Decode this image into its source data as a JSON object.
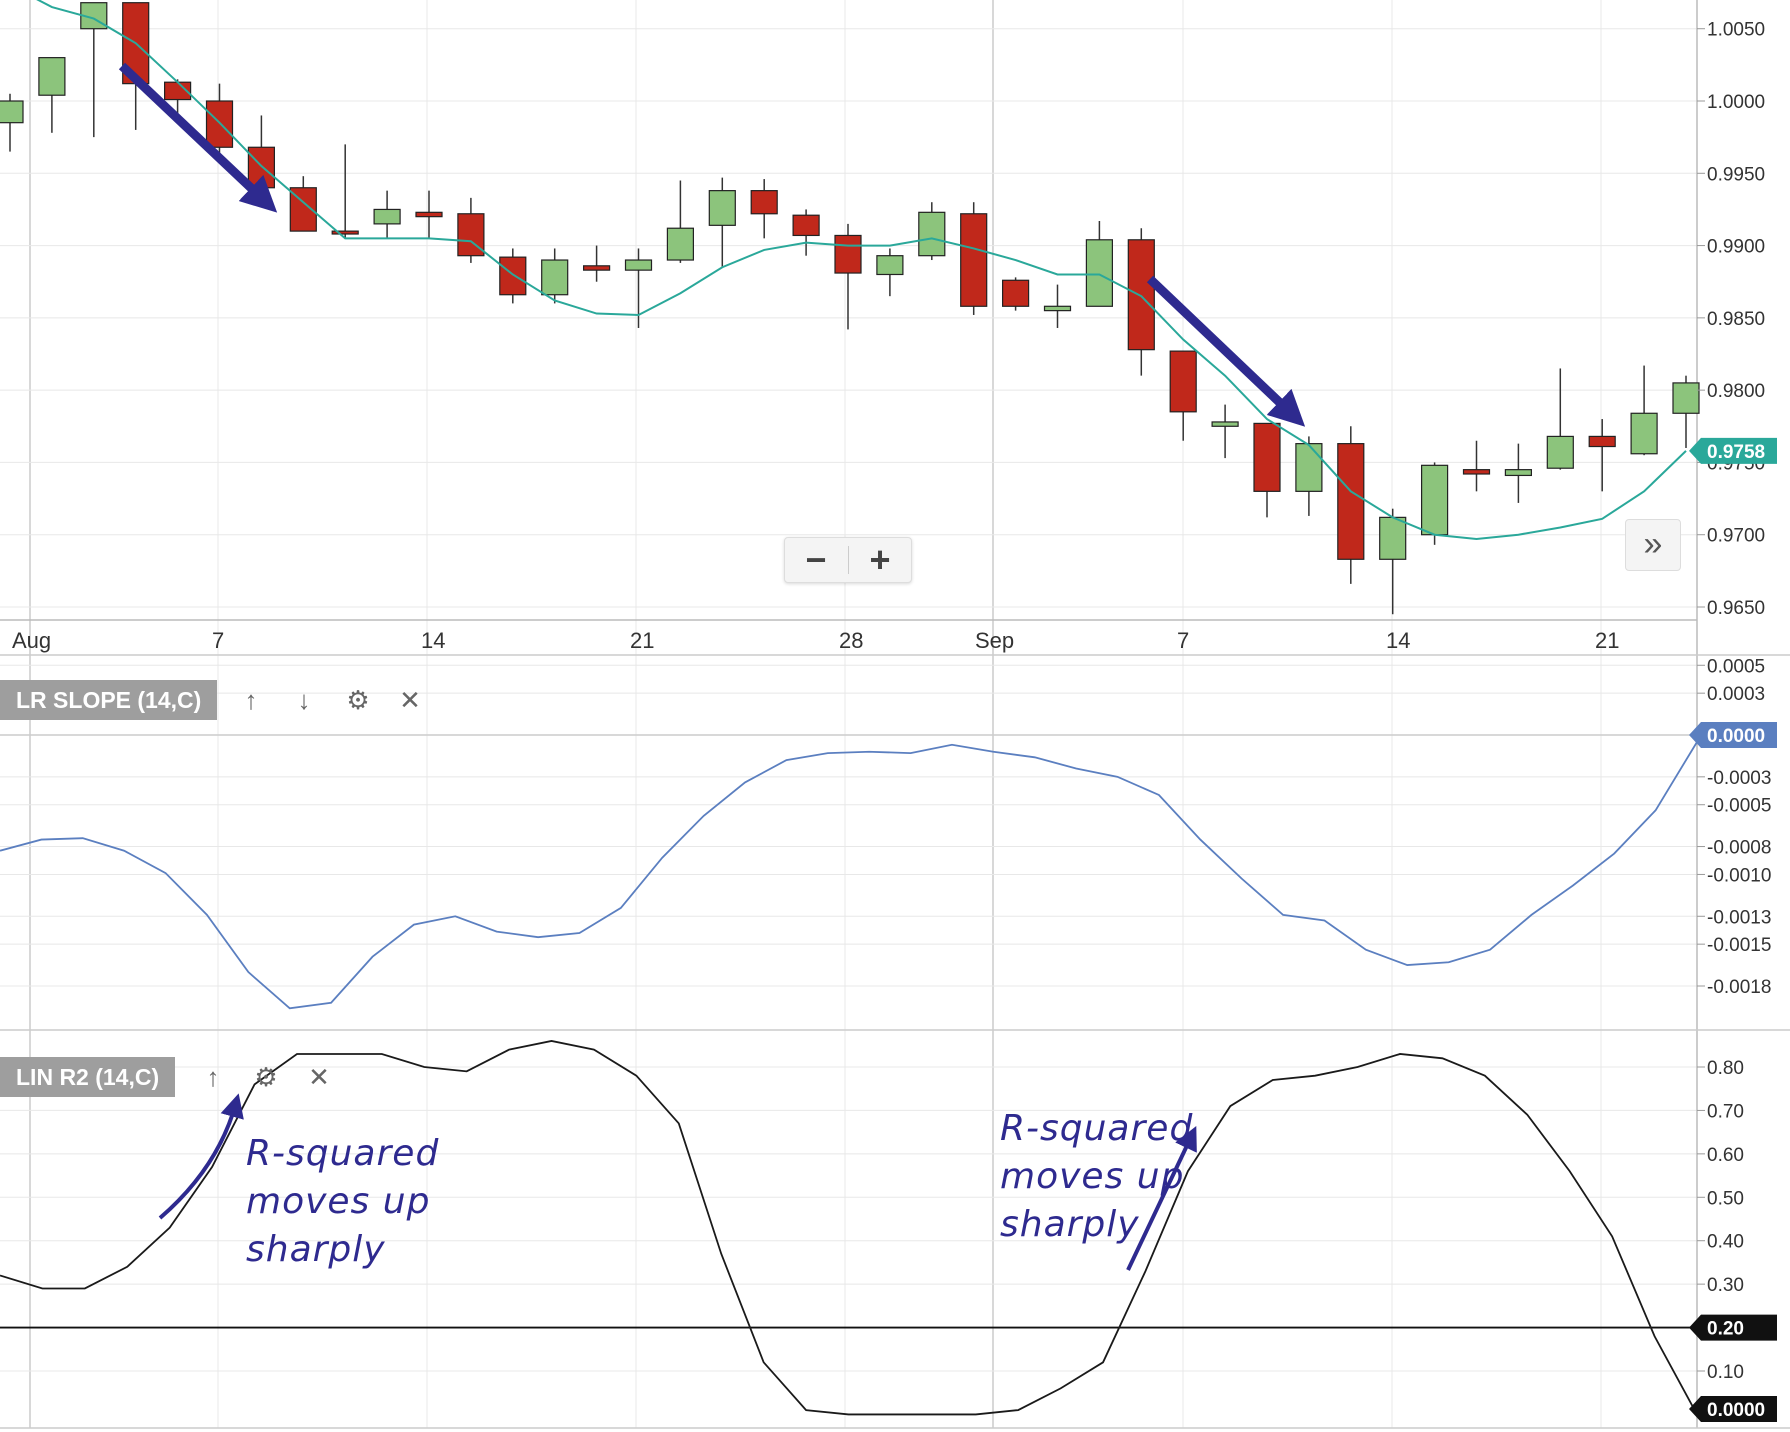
{
  "colors": {
    "up": "#8cc47c",
    "down": "#c0281b",
    "sma": "#2aa89a",
    "slope": "#5b7fc0",
    "r2": "#1a1a1a",
    "grid": "#e8e8e8",
    "arrow": "#2e2a8f",
    "badge_last": "#2aa89a",
    "badge_slope": "#5b7fc0",
    "badge_r2": "#111111"
  },
  "panels": {
    "slope_label": "LR SLOPE (14,C)",
    "r2_label": "LIN R2 (14,C)"
  },
  "icons": {
    "up": "arrow-up-icon",
    "down": "arrow-down-icon",
    "settings": "gear-icon",
    "close": "close-icon",
    "zoom_out": "minus-icon",
    "zoom_in": "plus-icon",
    "scroll": "double-chevron-right-icon"
  },
  "controls": {
    "up": "↑",
    "down": "↓",
    "settings": "⚙",
    "close": "✕",
    "zoom_out": "−",
    "zoom_in": "+",
    "scroll": "»"
  },
  "annotations": [
    {
      "lines": [
        "R-squared",
        "moves up",
        "sharply"
      ]
    },
    {
      "lines": [
        "R-squared",
        "moves up",
        "sharply"
      ]
    }
  ],
  "chart_data": [
    {
      "type": "candlestick",
      "x_labels": [
        "Aug",
        "7",
        "14",
        "21",
        "28",
        "Sep",
        "7",
        "14",
        "21"
      ],
      "ylim": [
        0.964,
        1.0068
      ],
      "y_ticks": [
        "0.9650",
        "0.9700",
        "0.9750",
        "0.9800",
        "0.9850",
        "0.9900",
        "0.9950",
        "1.0000",
        "1.0050"
      ],
      "last_value": "0.9758",
      "candles": [
        {
          "o": 0.9985,
          "h": 1.0005,
          "l": 0.9965,
          "c": 1.0
        },
        {
          "o": 1.0004,
          "h": 1.0024,
          "l": 0.9978,
          "c": 1.003
        },
        {
          "o": 1.005,
          "h": 1.0068,
          "l": 0.9975,
          "c": 1.0068
        },
        {
          "o": 1.0068,
          "h": 1.0068,
          "l": 0.998,
          "c": 1.0012
        },
        {
          "o": 1.0013,
          "h": 1.0015,
          "l": 0.999,
          "c": 1.0001
        },
        {
          "o": 1.0,
          "h": 1.0012,
          "l": 0.9958,
          "c": 0.9968
        },
        {
          "o": 0.9968,
          "h": 0.999,
          "l": 0.9932,
          "c": 0.994
        },
        {
          "o": 0.994,
          "h": 0.9948,
          "l": 0.991,
          "c": 0.991
        },
        {
          "o": 0.991,
          "h": 0.997,
          "l": 0.9905,
          "c": 0.9908
        },
        {
          "o": 0.9915,
          "h": 0.9938,
          "l": 0.9905,
          "c": 0.9925
        },
        {
          "o": 0.9923,
          "h": 0.9938,
          "l": 0.9905,
          "c": 0.992
        },
        {
          "o": 0.9922,
          "h": 0.9933,
          "l": 0.9888,
          "c": 0.9893
        },
        {
          "o": 0.9892,
          "h": 0.9898,
          "l": 0.986,
          "c": 0.9866
        },
        {
          "o": 0.9866,
          "h": 0.9898,
          "l": 0.986,
          "c": 0.989
        },
        {
          "o": 0.9886,
          "h": 0.99,
          "l": 0.9875,
          "c": 0.9883
        },
        {
          "o": 0.9883,
          "h": 0.9898,
          "l": 0.9843,
          "c": 0.989
        },
        {
          "o": 0.989,
          "h": 0.9945,
          "l": 0.9888,
          "c": 0.9912
        },
        {
          "o": 0.9914,
          "h": 0.9947,
          "l": 0.9885,
          "c": 0.9938
        },
        {
          "o": 0.9938,
          "h": 0.9946,
          "l": 0.9905,
          "c": 0.9922
        },
        {
          "o": 0.9921,
          "h": 0.9925,
          "l": 0.9893,
          "c": 0.9907
        },
        {
          "o": 0.9907,
          "h": 0.9915,
          "l": 0.9842,
          "c": 0.9881
        },
        {
          "o": 0.988,
          "h": 0.9898,
          "l": 0.9865,
          "c": 0.9893
        },
        {
          "o": 0.9893,
          "h": 0.993,
          "l": 0.989,
          "c": 0.9923
        },
        {
          "o": 0.9922,
          "h": 0.993,
          "l": 0.9852,
          "c": 0.9858
        },
        {
          "o": 0.9876,
          "h": 0.9878,
          "l": 0.9855,
          "c": 0.9858
        },
        {
          "o": 0.9855,
          "h": 0.9873,
          "l": 0.9843,
          "c": 0.9858
        },
        {
          "o": 0.9858,
          "h": 0.9917,
          "l": 0.9858,
          "c": 0.9904
        },
        {
          "o": 0.9904,
          "h": 0.9912,
          "l": 0.981,
          "c": 0.9828
        },
        {
          "o": 0.9827,
          "h": 0.9827,
          "l": 0.9765,
          "c": 0.9785
        },
        {
          "o": 0.9775,
          "h": 0.979,
          "l": 0.9753,
          "c": 0.9778
        },
        {
          "o": 0.9777,
          "h": 0.9777,
          "l": 0.9712,
          "c": 0.973
        },
        {
          "o": 0.973,
          "h": 0.9768,
          "l": 0.9713,
          "c": 0.9763
        },
        {
          "o": 0.9763,
          "h": 0.9775,
          "l": 0.9666,
          "c": 0.9683
        },
        {
          "o": 0.9683,
          "h": 0.9718,
          "l": 0.9645,
          "c": 0.9712
        },
        {
          "o": 0.97,
          "h": 0.975,
          "l": 0.9693,
          "c": 0.9748
        },
        {
          "o": 0.9745,
          "h": 0.9765,
          "l": 0.973,
          "c": 0.9742
        },
        {
          "o": 0.9741,
          "h": 0.9763,
          "l": 0.9722,
          "c": 0.9745
        },
        {
          "o": 0.9746,
          "h": 0.9815,
          "l": 0.9745,
          "c": 0.9768
        },
        {
          "o": 0.9768,
          "h": 0.978,
          "l": 0.973,
          "c": 0.9761
        },
        {
          "o": 0.9756,
          "h": 0.9817,
          "l": 0.9755,
          "c": 0.9784
        },
        {
          "o": 0.9784,
          "h": 0.981,
          "l": 0.976,
          "c": 0.9805
        }
      ],
      "sma": [
        1.008,
        1.0065,
        1.0057,
        1.004,
        1.0013,
        0.9985,
        0.9955,
        0.993,
        0.9905,
        0.9905,
        0.9905,
        0.9903,
        0.988,
        0.9862,
        0.9853,
        0.9852,
        0.9867,
        0.9885,
        0.9897,
        0.9902,
        0.99,
        0.99,
        0.9905,
        0.9898,
        0.989,
        0.988,
        0.988,
        0.9865,
        0.9835,
        0.981,
        0.978,
        0.9762,
        0.973,
        0.9712,
        0.97,
        0.9697,
        0.97,
        0.9705,
        0.9711,
        0.973,
        0.9758
      ]
    },
    {
      "type": "line",
      "title": "LR SLOPE (14,C)",
      "ylim": [
        -0.002,
        0.0005
      ],
      "y_ticks": [
        "0.0005",
        "0.0003",
        "0.0000",
        "-0.0003",
        "-0.0005",
        "-0.0008",
        "-0.0010",
        "-0.0013",
        "-0.0015",
        "-0.0018"
      ],
      "last_value": "0.0000",
      "values": [
        -0.00083,
        -0.00075,
        -0.00074,
        -0.00083,
        -0.00099,
        -0.00129,
        -0.0017,
        -0.00196,
        -0.00192,
        -0.00159,
        -0.00136,
        -0.0013,
        -0.00141,
        -0.00145,
        -0.00142,
        -0.00124,
        -0.00088,
        -0.00058,
        -0.00034,
        -0.00018,
        -0.00013,
        -0.00012,
        -0.00013,
        -7e-05,
        -0.00012,
        -0.00016,
        -0.00024,
        -0.0003,
        -0.00043,
        -0.00075,
        -0.00103,
        -0.00129,
        -0.00133,
        -0.00154,
        -0.00165,
        -0.00163,
        -0.00154,
        -0.00129,
        -0.00108,
        -0.00085,
        -0.00054,
        -5e-05
      ]
    },
    {
      "type": "line",
      "title": "LIN R2 (14,C)",
      "ylim": [
        -0.01,
        0.85
      ],
      "y_ticks": [
        "0.80",
        "0.70",
        "0.60",
        "0.50",
        "0.40",
        "0.30",
        "0.20",
        "0.10"
      ],
      "reference_line": 0.2,
      "reference_label": "0.20",
      "last_value": "0.0000",
      "values": [
        0.32,
        0.29,
        0.29,
        0.34,
        0.43,
        0.57,
        0.76,
        0.83,
        0.83,
        0.83,
        0.8,
        0.79,
        0.84,
        0.86,
        0.84,
        0.78,
        0.67,
        0.37,
        0.12,
        0.01,
        0.0,
        0.0,
        0.0,
        0.0,
        0.01,
        0.06,
        0.12,
        0.33,
        0.56,
        0.71,
        0.77,
        0.78,
        0.8,
        0.83,
        0.82,
        0.78,
        0.69,
        0.56,
        0.41,
        0.18,
        0.0
      ]
    }
  ]
}
